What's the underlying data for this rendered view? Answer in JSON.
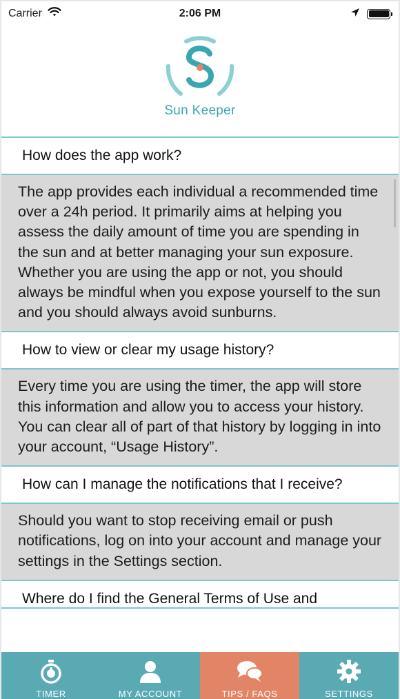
{
  "status_bar": {
    "carrier": "Carrier",
    "time": "2:06 PM"
  },
  "header": {
    "app_name": "Sun Keeper",
    "logo_letter": "S"
  },
  "faqs": [
    {
      "question": "How does the app work?",
      "answer": "The app provides each individual a recommended time over a 24h period. It primarily aims at helping you assess the daily amount of time you are spending in the sun and at better managing your sun exposure. Whether you are using the app or not, you should always be mindful when you expose yourself to the sun and you should always avoid sunburns."
    },
    {
      "question": "How to view or clear my usage history?",
      "answer": "Every time you are using the timer, the app will store this information and allow you to access your history. You can clear all of part of that history by logging in into your account, “Usage History”."
    },
    {
      "question": "How can I manage the notifications that I receive?",
      "answer": "Should you want to stop receiving email or push notifications, log on into your account and manage your settings in the Settings section."
    },
    {
      "question": "Where do I find the General Terms of Use and"
    }
  ],
  "tab_bar": {
    "tabs": [
      {
        "label": "TIMER",
        "icon": "stopwatch-icon"
      },
      {
        "label": "MY ACCOUNT",
        "icon": "user-icon"
      },
      {
        "label": "TIPS / FAQS",
        "icon": "chat-bubbles-icon",
        "active": true
      },
      {
        "label": "SETTINGS",
        "icon": "gear-icon"
      }
    ]
  },
  "colors": {
    "accent": "#5aaab4",
    "active_tab": "#e18566",
    "answer_bg": "#d8d8d8",
    "logo_teal": "#3aa6b0",
    "logo_dot": "#e18566"
  }
}
